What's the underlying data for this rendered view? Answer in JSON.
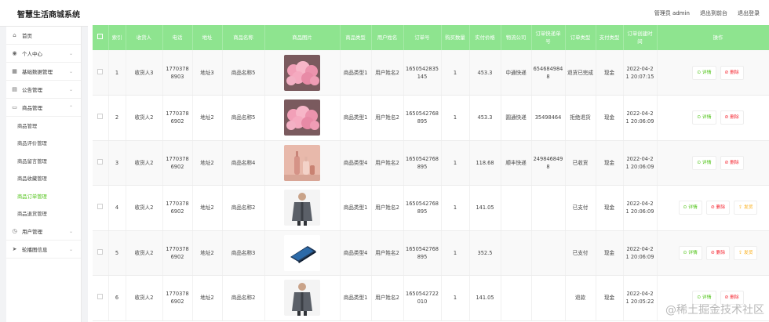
{
  "app": {
    "title": "智慧生活商城系统"
  },
  "top_links": {
    "admin": "管理员 admin",
    "front": "退出到前台",
    "logout": "退出登录"
  },
  "sidebar": {
    "items": [
      {
        "label": "首页",
        "icon": "home-icon",
        "chevron": false
      },
      {
        "label": "个人中心",
        "icon": "user-icon",
        "chevron": true
      },
      {
        "label": "基础数据管理",
        "icon": "database-icon",
        "chevron": true
      },
      {
        "label": "公告管理",
        "icon": "notice-icon",
        "chevron": true
      },
      {
        "label": "商品管理",
        "icon": "goods-icon",
        "chevron": true,
        "expanded": true
      }
    ],
    "sub_items": [
      {
        "label": "商品管理",
        "active": false
      },
      {
        "label": "商品评价管理",
        "active": false
      },
      {
        "label": "商品留言管理",
        "active": false
      },
      {
        "label": "商品收藏管理",
        "active": false
      },
      {
        "label": "商品订单管理",
        "active": true
      },
      {
        "label": "商品退货管理",
        "active": false
      }
    ],
    "bottom_items": [
      {
        "label": "用户管理",
        "icon": "clock-icon",
        "chevron": true
      },
      {
        "label": "轮播图信息",
        "icon": "send-icon",
        "chevron": true
      }
    ]
  },
  "table": {
    "headers": [
      "",
      "索引",
      "收货人",
      "电话",
      "地址",
      "商品名称",
      "商品图片",
      "商品类型",
      "用户姓名",
      "订单号",
      "购买数量",
      "实付价格",
      "物流公司",
      "订单快递单号",
      "订单类型",
      "支付类型",
      "订单创建时间",
      "操作"
    ],
    "op_labels": {
      "detail": "详情",
      "delete": "删除",
      "ship": "发货"
    },
    "rows": [
      {
        "index": "1",
        "receiver": "收货人3",
        "phone": "17703788903",
        "address": "地址3",
        "product": "商品名称5",
        "image": "flowers",
        "type": "商品类型1",
        "user": "用户姓名2",
        "order_no": "1650542835145",
        "qty": "1",
        "price": "453.3",
        "carrier": "中通快递",
        "tracking": "6546849848",
        "status": "退货已完成",
        "pay": "现金",
        "created": "2022-04-21 20:07:15",
        "ship": false
      },
      {
        "index": "2",
        "receiver": "收货人2",
        "phone": "17703786902",
        "address": "地址2",
        "product": "商品名称5",
        "image": "flowers",
        "type": "商品类型1",
        "user": "用户姓名2",
        "order_no": "1650542768895",
        "qty": "1",
        "price": "453.3",
        "carrier": "圆通快递",
        "tracking": "35498464",
        "status": "拒绝退货",
        "pay": "现金",
        "created": "2022-04-21 20:06:09",
        "ship": false
      },
      {
        "index": "3",
        "receiver": "收货人2",
        "phone": "17703786902",
        "address": "地址2",
        "product": "商品名称4",
        "image": "bottles",
        "type": "商品类型4",
        "user": "用户姓名2",
        "order_no": "1650542768895",
        "qty": "1",
        "price": "118.68",
        "carrier": "顺丰快递",
        "tracking": "2498468498",
        "status": "已收货",
        "pay": "现金",
        "created": "2022-04-21 20:06:09",
        "ship": false
      },
      {
        "index": "4",
        "receiver": "收货人2",
        "phone": "17703786902",
        "address": "地址2",
        "product": "商品名称2",
        "image": "jacket",
        "type": "商品类型1",
        "user": "用户姓名2",
        "order_no": "1650542768895",
        "qty": "1",
        "price": "141.05",
        "carrier": "",
        "tracking": "",
        "status": "已支付",
        "pay": "现金",
        "created": "2022-04-21 20:06:09",
        "ship": true
      },
      {
        "index": "5",
        "receiver": "收货人2",
        "phone": "17703786902",
        "address": "地址2",
        "product": "商品名称3",
        "image": "laptop",
        "type": "商品类型4",
        "user": "用户姓名2",
        "order_no": "1650542768895",
        "qty": "1",
        "price": "352.5",
        "carrier": "",
        "tracking": "",
        "status": "已支付",
        "pay": "现金",
        "created": "2022-04-21 20:06:09",
        "ship": true
      },
      {
        "index": "6",
        "receiver": "收货人2",
        "phone": "17703786902",
        "address": "地址2",
        "product": "商品名称2",
        "image": "jacket",
        "type": "商品类型1",
        "user": "用户姓名2",
        "order_no": "1650542722010",
        "qty": "1",
        "price": "141.05",
        "carrier": "",
        "tracking": "",
        "status": "退款",
        "pay": "现金",
        "created": "2022-04-21 20:05:22",
        "ship": false
      }
    ]
  },
  "watermark": "@稀土掘金技术社区",
  "colors": {
    "header_green": "#8ee48f",
    "active_green": "#52c41a",
    "delete_red": "#f5222d",
    "ship_orange": "#faad14"
  }
}
